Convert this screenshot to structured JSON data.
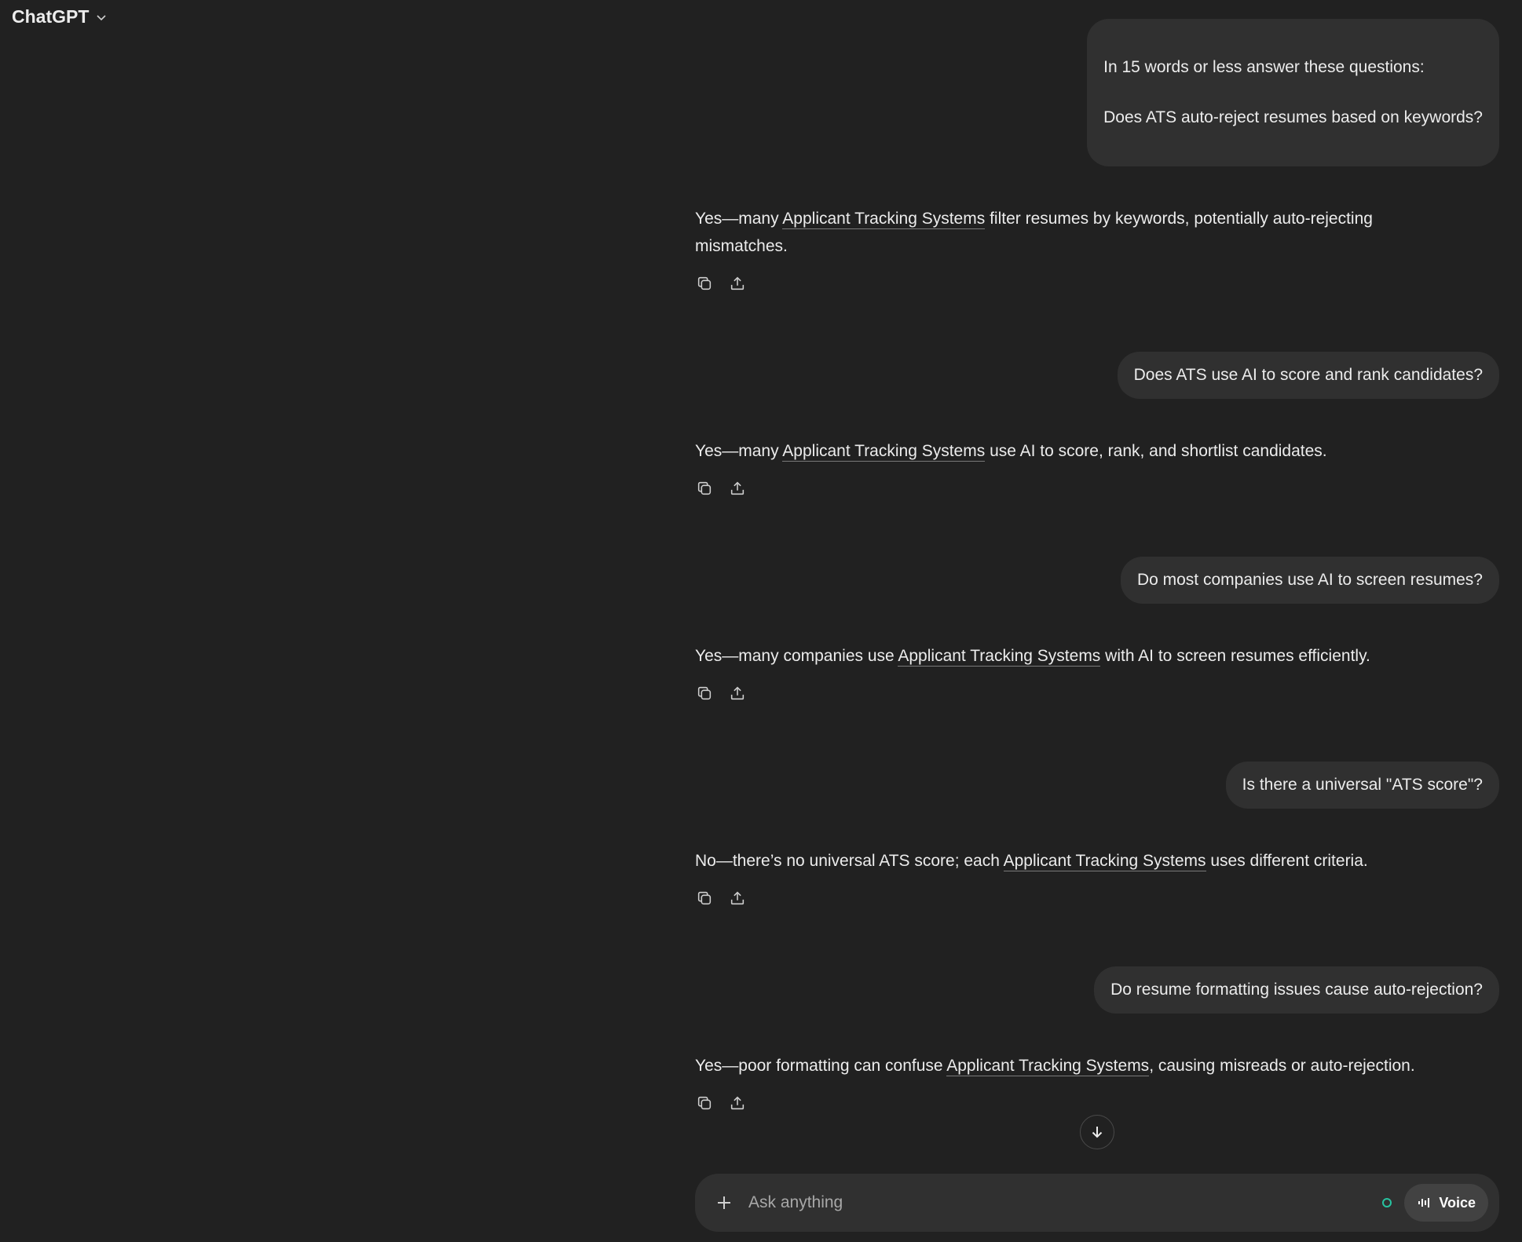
{
  "header": {
    "model_label": "ChatGPT"
  },
  "conversation": [
    {
      "user": {
        "line1": "In 15 words or less answer these questions:",
        "line2": "Does ATS auto-reject resumes based on keywords?"
      },
      "assistant": {
        "pre": "Yes—many ",
        "term": "Applicant Tracking Systems",
        "post": " filter resumes by keywords, potentially auto-rejecting mismatches."
      }
    },
    {
      "user": {
        "text": "Does ATS use AI to score and rank candidates?"
      },
      "assistant": {
        "pre": "Yes—many ",
        "term": "Applicant Tracking Systems",
        "post": " use AI to score, rank, and shortlist candidates."
      }
    },
    {
      "user": {
        "text": "Do most companies use AI to screen resumes?"
      },
      "assistant": {
        "pre": "Yes—many companies use ",
        "term": "Applicant Tracking Systems",
        "post": " with AI to screen resumes efficiently."
      }
    },
    {
      "user": {
        "text": "Is there a universal \"ATS score\"?"
      },
      "assistant": {
        "pre": "No—there’s no universal ATS score; each ",
        "term": "Applicant Tracking Systems",
        "post": " uses different criteria."
      }
    },
    {
      "user": {
        "text": "Do resume formatting issues cause auto-rejection?"
      },
      "assistant": {
        "pre": "Yes—poor formatting can confuse ",
        "term": "Applicant Tracking Systems",
        "post": ", causing misreads or auto-rejection."
      }
    }
  ],
  "composer": {
    "placeholder": "Ask anything",
    "voice_label": "Voice"
  },
  "icons": {
    "model_dropdown": "chevron-down-icon",
    "copy": "copy-icon",
    "share": "share-icon",
    "scroll_down": "arrow-down-icon",
    "add": "plus-icon",
    "voice": "waveform-icon"
  },
  "colors": {
    "background": "#212121",
    "user_bubble": "#303030",
    "composer": "#303030",
    "voice_button": "#424242",
    "status_dot": "#27c3a0",
    "text": "#ececec"
  }
}
